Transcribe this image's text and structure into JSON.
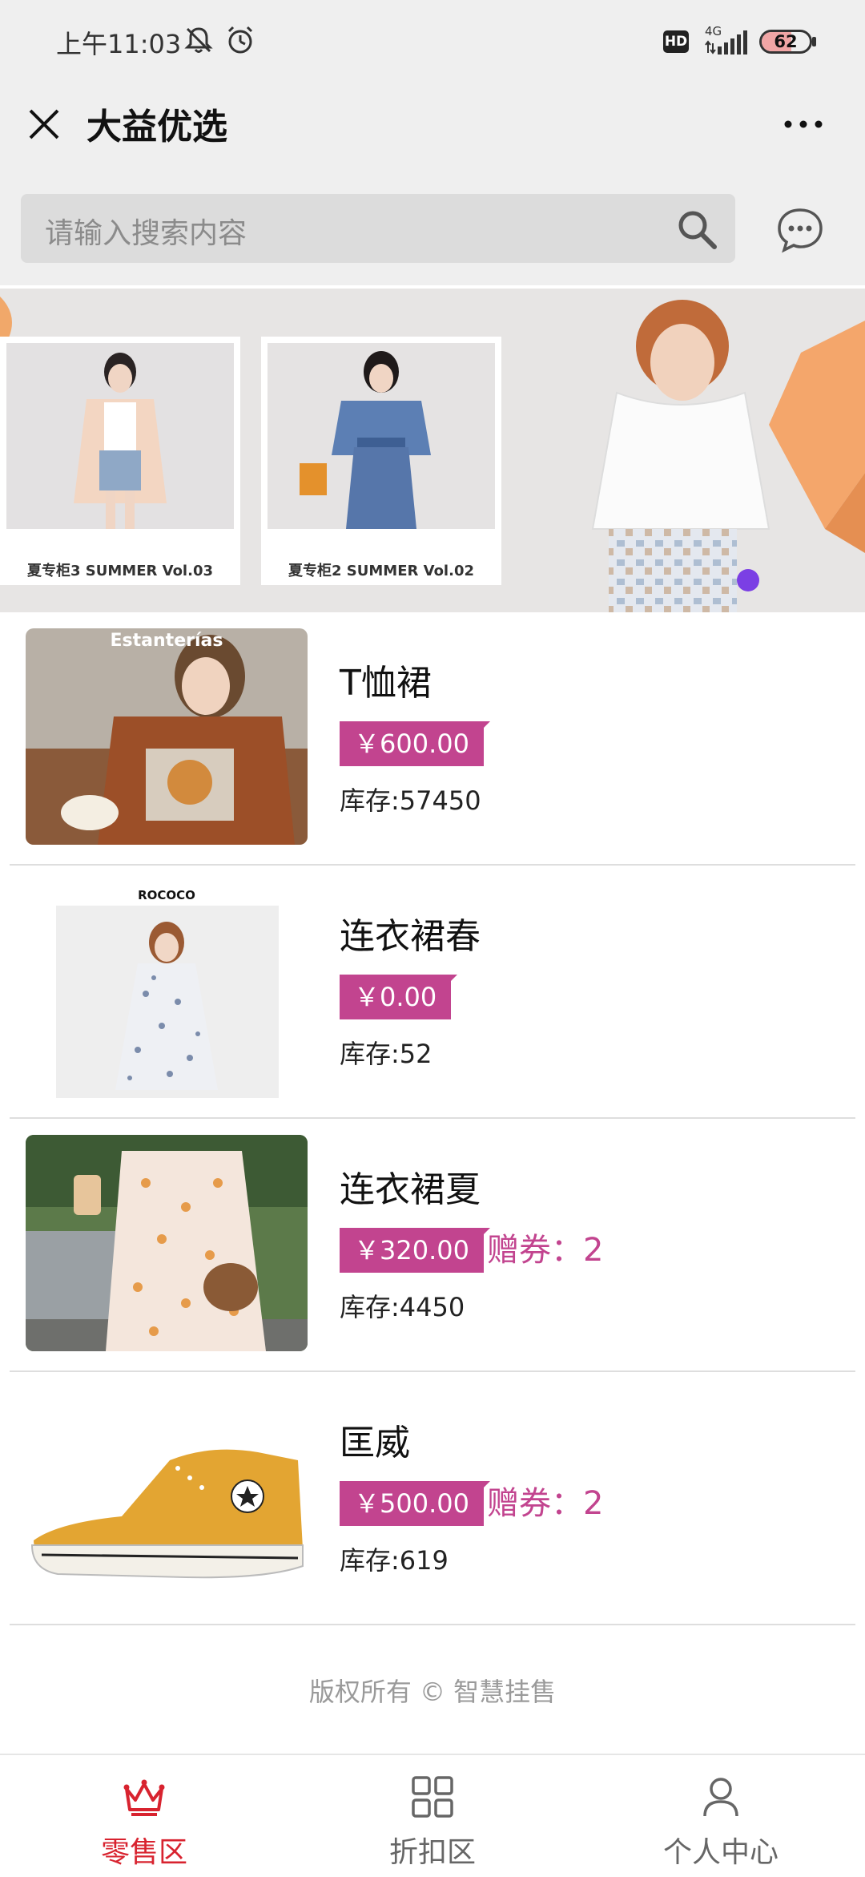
{
  "status_bar": {
    "time": "上午11:03",
    "hd": "HD",
    "network": "4G",
    "battery_level": 62,
    "battery_text": "62",
    "icons": [
      "mute-bell-icon",
      "alarm-icon",
      "signal-icon",
      "battery-icon"
    ]
  },
  "nav": {
    "title": "大益优选",
    "close_icon": "close-icon",
    "more_icon": "more-icon"
  },
  "search": {
    "placeholder": "请输入搜索内容",
    "icon": "search-icon",
    "message_icon": "message-icon"
  },
  "banner": {
    "cards": [
      {
        "caption": "夏专柜3 SUMMER Vol.03"
      },
      {
        "caption": "夏专柜2 SUMMER Vol.02"
      }
    ]
  },
  "products": [
    {
      "name": "T恤裙",
      "price": "￥600.00",
      "coupon": "",
      "stock": "库存:57450",
      "image_label": "Estanterías"
    },
    {
      "name": "连衣裙春",
      "price": "￥0.00",
      "coupon": "",
      "stock": "库存:52",
      "image_label": "ROCOCO"
    },
    {
      "name": "连衣裙夏",
      "price": "￥320.00",
      "coupon": "赠券：2",
      "stock": "库存:4450",
      "image_label": ""
    },
    {
      "name": "匡威",
      "price": "￥500.00",
      "coupon": "赠券：2",
      "stock": "库存:619",
      "image_label": ""
    }
  ],
  "footer": {
    "copyright": "版权所有 © 智慧挂售"
  },
  "tabs": [
    {
      "label": "零售区",
      "icon": "crown-icon",
      "active": true
    },
    {
      "label": "折扣区",
      "icon": "grid-icon",
      "active": false
    },
    {
      "label": "个人中心",
      "icon": "person-icon",
      "active": false
    }
  ],
  "colors": {
    "accent": "#c2448f",
    "tab_active": "#d8232f",
    "tab_inactive": "#666666"
  }
}
